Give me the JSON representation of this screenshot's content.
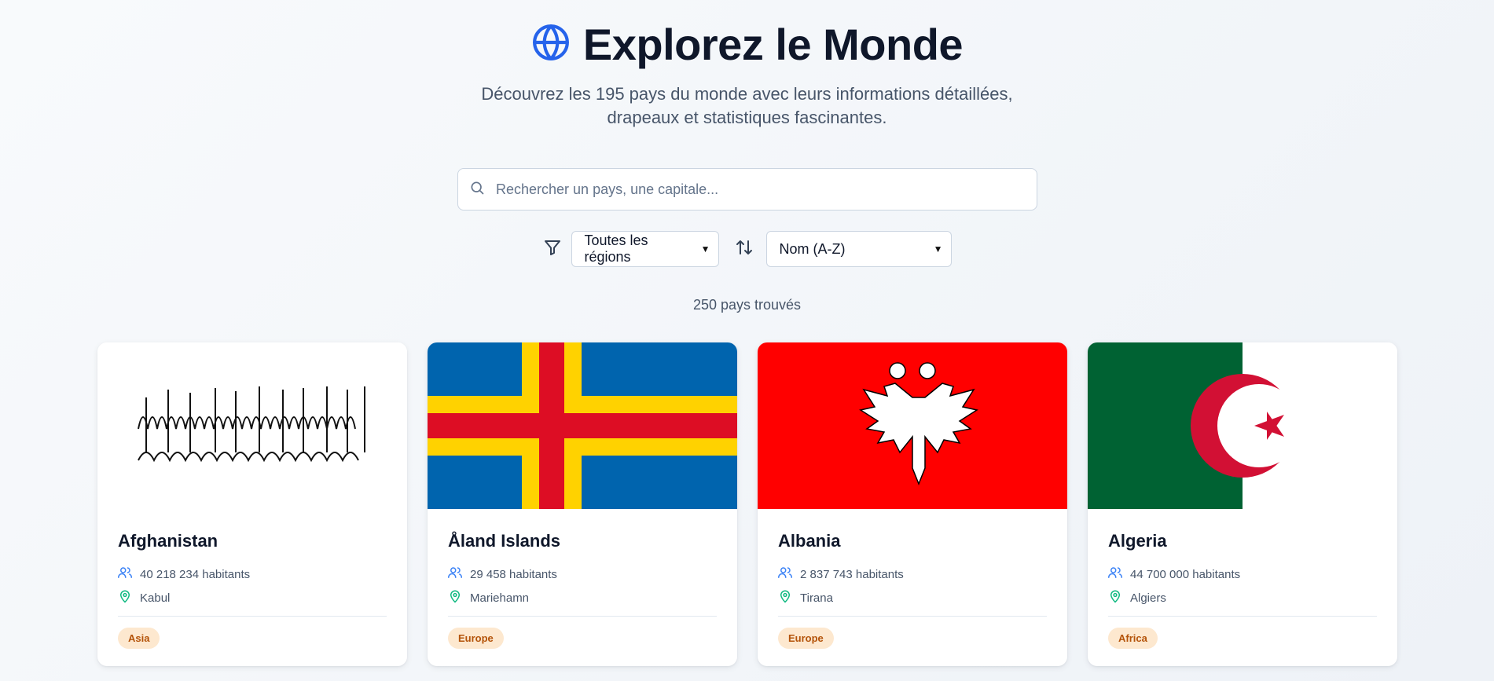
{
  "header": {
    "title": "Explorez le Monde",
    "subtitle": "Découvrez les 195 pays du monde avec leurs informations détaillées, drapeaux et statistiques fascinantes.",
    "icon": "globe-icon",
    "accent": "#2563eb"
  },
  "search": {
    "placeholder": "Rechercher un pays, une capitale...",
    "value": ""
  },
  "filters": {
    "region_selected": "Toutes les régions",
    "sort_selected": "Nom (A-Z)"
  },
  "results": {
    "count_text": "250 pays trouvés"
  },
  "countries": [
    {
      "name": "Afghanistan",
      "population": "40 218 234 habitants",
      "capital": "Kabul",
      "region": "Asia"
    },
    {
      "name": "Åland Islands",
      "population": "29 458 habitants",
      "capital": "Mariehamn",
      "region": "Europe"
    },
    {
      "name": "Albania",
      "population": "2 837 743 habitants",
      "capital": "Tirana",
      "region": "Europe"
    },
    {
      "name": "Algeria",
      "population": "44 700 000 habitants",
      "capital": "Algiers",
      "region": "Africa"
    }
  ],
  "colors": {
    "population_icon": "#3b82f6",
    "capital_icon": "#10b981",
    "badge_bg": "#fde8cf",
    "badge_text": "#b45309"
  }
}
